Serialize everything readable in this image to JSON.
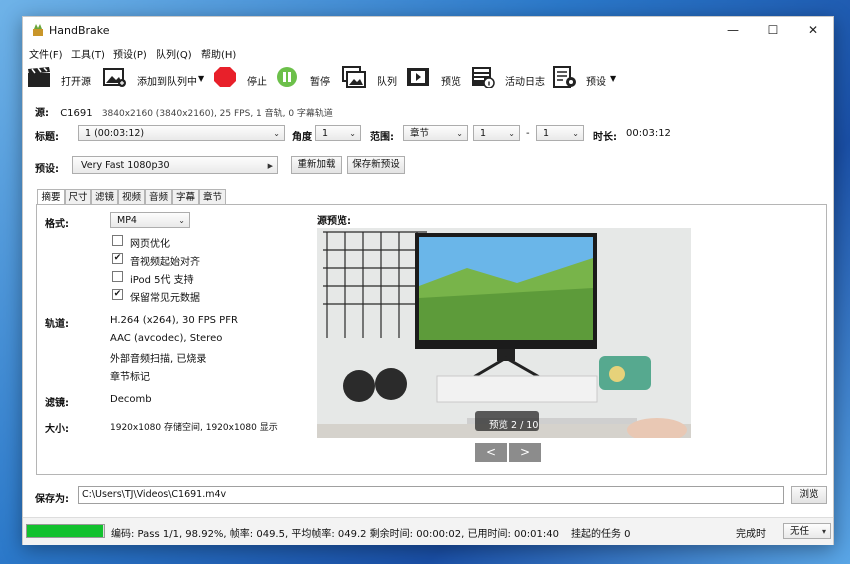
{
  "window": {
    "title": "HandBrake"
  },
  "menu": [
    "文件(F)",
    "工具(T)",
    "预设(P)",
    "队列(Q)",
    "帮助(H)"
  ],
  "toolbar": {
    "open_source": "打开源",
    "add_to_queue": "添加到队列中",
    "stop": "停止",
    "pause": "暂停",
    "queue": "队列",
    "preview": "预览",
    "activity_log": "活动日志",
    "presets": "预设"
  },
  "source": {
    "label": "源:",
    "name": "C1691",
    "info": "3840x2160 (3840x2160), 25 FPS, 1 音轨, 0 字幕轨道"
  },
  "title_row": {
    "title_label": "标题:",
    "title_value": "1  (00:03:12)",
    "angle_label": "角度",
    "angle_value": "1",
    "range_label": "范围:",
    "range_value": "章节",
    "range_start": "1",
    "range_sep": "-",
    "range_end": "1",
    "duration_label": "时长:",
    "duration_value": "00:03:12"
  },
  "preset_row": {
    "label": "预设:",
    "value": "Very Fast 1080p30",
    "reload": "重新加载",
    "save_new": "保存新预设"
  },
  "tabs": [
    "摘要",
    "尺寸",
    "滤镜",
    "视频",
    "音频",
    "字幕",
    "章节"
  ],
  "summary": {
    "format_label": "格式:",
    "format_value": "MP4",
    "options": [
      {
        "label": "网页优化",
        "checked": false
      },
      {
        "label": "音视频起始对齐",
        "checked": true
      },
      {
        "label": "iPod 5代 支持",
        "checked": false
      },
      {
        "label": "保留常见元数据",
        "checked": true
      }
    ],
    "tracks_label": "轨道:",
    "tracks": [
      "H.264 (x264), 30 FPS PFR",
      "AAC (avcodec), Stereo",
      "外部音频扫描, 已烧录",
      "章节标记"
    ],
    "filters_label": "滤镜:",
    "filters_value": "Decomb",
    "size_label": "大小:",
    "size_value": "1920x1080 存储空间, 1920x1080 显示",
    "preview_label": "源预览:",
    "preview_badge": "预览 2 / 10",
    "prev_btn": "<",
    "next_btn": ">"
  },
  "save_as": {
    "label": "保存为:",
    "path": "C:\\Users\\TJ\\Videos\\C1691.m4v",
    "browse": "浏览"
  },
  "status": {
    "progress_fraction": 0.9892,
    "text": "编码: Pass 1/1,  98.92%,  帧率: 049.5,  平均帧率: 049.2 剩余时间: 00:00:02,  已用时间: 00:01:40",
    "queue_pending": "挂起的任务 0",
    "when_done_partial": "完成时",
    "when_done_value": "无任"
  },
  "colors": {
    "stop": "#e8202a",
    "pause": "#6cc04a",
    "progress": "#12c12e"
  }
}
